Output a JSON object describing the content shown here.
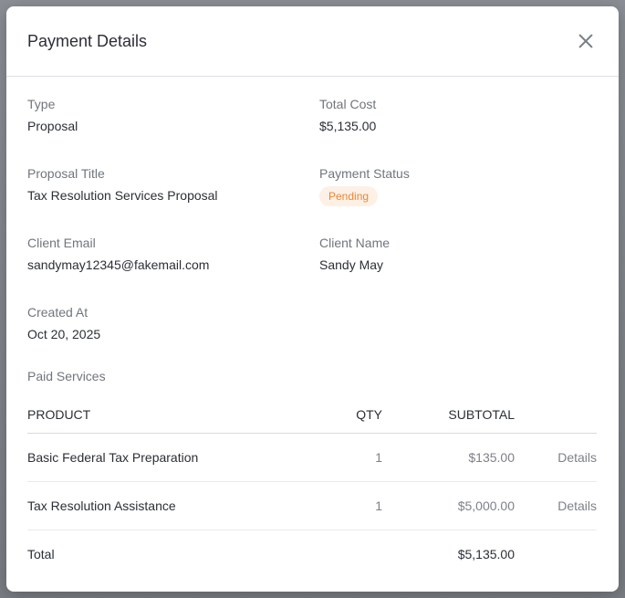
{
  "modal": {
    "title": "Payment Details"
  },
  "fields": {
    "type": {
      "label": "Type",
      "value": "Proposal"
    },
    "total_cost": {
      "label": "Total Cost",
      "value": "$5,135.00"
    },
    "proposal_title": {
      "label": "Proposal Title",
      "value": "Tax Resolution Services Proposal"
    },
    "payment_status": {
      "label": "Payment Status",
      "value": "Pending"
    },
    "client_email": {
      "label": "Client Email",
      "value": "sandymay12345@fakemail.com"
    },
    "client_name": {
      "label": "Client Name",
      "value": "Sandy May"
    },
    "created_at": {
      "label": "Created At",
      "value": "Oct 20, 2025"
    }
  },
  "services": {
    "section_label": "Paid Services",
    "headers": {
      "product": "PRODUCT",
      "qty": "QTY",
      "subtotal": "SUBTOTAL"
    },
    "rows": [
      {
        "product": "Basic Federal Tax Preparation",
        "qty": "1",
        "subtotal": "$135.00",
        "action": "Details"
      },
      {
        "product": "Tax Resolution Assistance",
        "qty": "1",
        "subtotal": "$5,000.00",
        "action": "Details"
      }
    ],
    "total": {
      "label": "Total",
      "value": "$5,135.00"
    }
  },
  "colors": {
    "badge_pending_bg": "#fdf0e4",
    "badge_pending_text": "#e6893a"
  }
}
